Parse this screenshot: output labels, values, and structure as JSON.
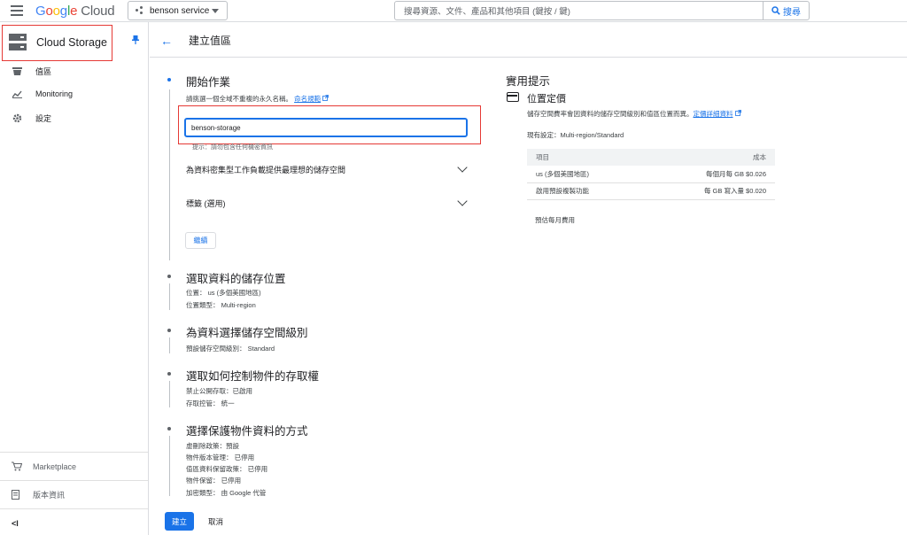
{
  "topbar": {
    "logo_parts": [
      "G",
      "o",
      "o",
      "g",
      "l",
      "e"
    ],
    "logo_cloud": "Cloud",
    "project": "benson service",
    "search_placeholder": "搜尋資源、文件、產品和其他項目 (鍵按 / 鍵)",
    "search_button": "搜尋"
  },
  "sidebar": {
    "title": "Cloud Storage",
    "items": [
      {
        "label": "值區",
        "icon": "bucket-icon"
      },
      {
        "label": "Monitoring",
        "icon": "chart-icon"
      },
      {
        "label": "設定",
        "icon": "gear-icon"
      }
    ],
    "bottom": [
      {
        "label": "Marketplace",
        "icon": "cart-icon"
      },
      {
        "label": "版本資訊",
        "icon": "notes-icon"
      }
    ],
    "collapse": "<I"
  },
  "header": {
    "back": "←",
    "title": "建立值區"
  },
  "form": {
    "step1": {
      "title": "開始作業",
      "instruction": "請挑選一個全域不重複的永久名稱。",
      "naming_link": "命名規範",
      "name_value": "benson-storage",
      "hint": "提示：請勿包含任何機密資訊",
      "expander1": "為資料密集型工作負載提供最理想的儲存空間",
      "expander2": "標籤 (選用)",
      "edit_button": "繼續"
    },
    "step2": {
      "title": "選取資料的儲存位置",
      "line1": "位置： us (多個美國地區)",
      "line2": "位置類型： Multi-region"
    },
    "step3": {
      "title": "為資料選擇儲存空間級別",
      "line1": "預設儲存空間級別： Standard"
    },
    "step4": {
      "title": "選取如何控制物件的存取權",
      "line1": "禁止公開存取：已啟用",
      "line2": "存取控管： 統一"
    },
    "step5": {
      "title": "選擇保護物件資料的方式",
      "line1": "虛刪除政策：預設",
      "line2": "物件版本管理： 已停用",
      "line3": "值區資料保留政策： 已停用",
      "line4": "物件保留： 已停用",
      "line5": "加密類型： 由 Google 代管"
    },
    "create_button": "建立",
    "cancel_button": "取消"
  },
  "tips": {
    "title": "實用提示",
    "subtitle": "位置定價",
    "description": "儲存空間費率會因資料的儲存空間級別和值區位置而異。",
    "pricing_link": "定價詳細資料",
    "current": "現有設定：Multi-region/Standard",
    "table_headers": [
      "項目",
      "成本"
    ],
    "table_rows": [
      [
        "us (多個美國地區)",
        "每個月每 GB $0.026"
      ],
      [
        "啟用預設複製功能",
        "每 GB 寫入量 $0.020"
      ]
    ],
    "estimate": "預估每月費用"
  },
  "colors": {
    "accent": "#1a73e8",
    "highlight": "#e53935"
  }
}
